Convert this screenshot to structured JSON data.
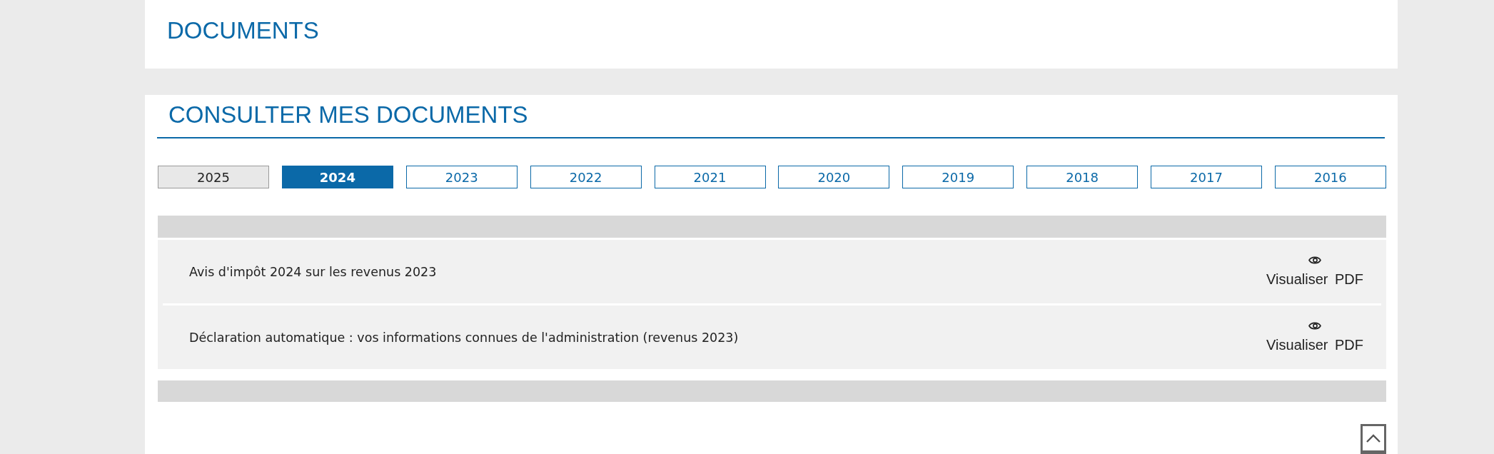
{
  "page_title": "DOCUMENTS",
  "section": {
    "title": "CONSULTER MES DOCUMENTS",
    "year_tabs": [
      {
        "label": "2025",
        "selected": false,
        "disabled": true
      },
      {
        "label": "2024",
        "selected": true,
        "disabled": false
      },
      {
        "label": "2023",
        "selected": false,
        "disabled": false
      },
      {
        "label": "2022",
        "selected": false,
        "disabled": false
      },
      {
        "label": "2021",
        "selected": false,
        "disabled": false
      },
      {
        "label": "2020",
        "selected": false,
        "disabled": false
      },
      {
        "label": "2019",
        "selected": false,
        "disabled": false
      },
      {
        "label": "2018",
        "selected": false,
        "disabled": false
      },
      {
        "label": "2017",
        "selected": false,
        "disabled": false
      },
      {
        "label": "2016",
        "selected": false,
        "disabled": false
      }
    ],
    "documents": [
      {
        "title": "Avis d'impôt 2024 sur les revenus 2023",
        "action": {
          "label": "Visualiser",
          "format": "PDF"
        }
      },
      {
        "title": "Déclaration automatique : vos informations connues de l'administration (revenus 2023)",
        "action": {
          "label": "Visualiser",
          "format": "PDF"
        }
      }
    ]
  }
}
